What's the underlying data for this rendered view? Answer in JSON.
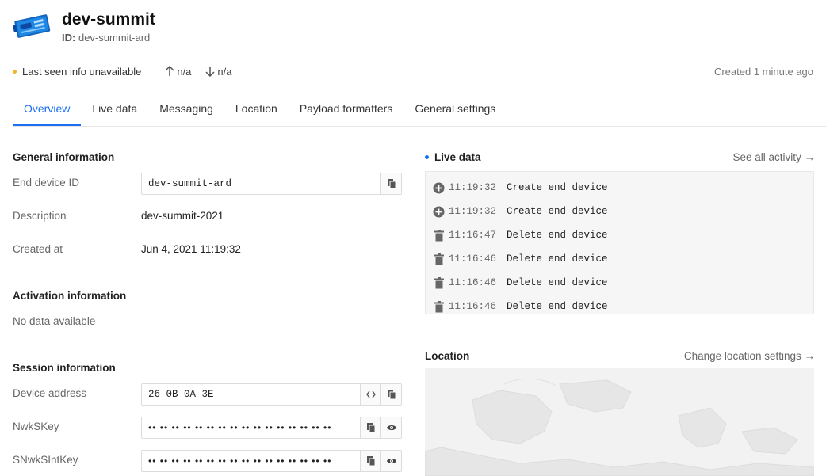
{
  "device": {
    "title": "dev-summit",
    "id_label": "ID:",
    "id_value": "dev-summit-ard"
  },
  "status": {
    "last_seen": "Last seen info unavailable",
    "uplink": "n/a",
    "downlink": "n/a",
    "created": "Created 1 minute ago",
    "warn_color": "#f0b429"
  },
  "tabs": [
    {
      "label": "Overview",
      "active": true
    },
    {
      "label": "Live data"
    },
    {
      "label": "Messaging"
    },
    {
      "label": "Location"
    },
    {
      "label": "Payload formatters"
    },
    {
      "label": "General settings"
    }
  ],
  "general": {
    "title": "General information",
    "end_device_id_label": "End device ID",
    "end_device_id": "dev-summit-ard",
    "description_label": "Description",
    "description": "dev-summit-2021",
    "created_at_label": "Created at",
    "created_at": "Jun 4, 2021 11:19:32"
  },
  "activation": {
    "title": "Activation information",
    "empty": "No data available"
  },
  "session": {
    "title": "Session information",
    "device_address_label": "Device address",
    "device_address": "26 0B 0A 3E",
    "nwkskey_label": "NwkSKey",
    "nwkskey": "•• •• •• •• •• •• •• •• •• •• •• •• •• •• •• ••",
    "snwksintkey_label": "SNwkSIntKey",
    "snwksintkey": "•• •• •• •• •• •• •• •• •• •• •• •• •• •• •• ••"
  },
  "live": {
    "title": "Live data",
    "see_all": "See all activity →",
    "accent": "#1a6ff3",
    "events": [
      {
        "icon": "plus-circle-icon",
        "time": "11:19:32",
        "text": "Create end device"
      },
      {
        "icon": "plus-circle-icon",
        "time": "11:19:32",
        "text": "Create end device"
      },
      {
        "icon": "trash-icon",
        "time": "11:16:47",
        "text": "Delete end device"
      },
      {
        "icon": "trash-icon",
        "time": "11:16:46",
        "text": "Delete end device"
      },
      {
        "icon": "trash-icon",
        "time": "11:16:46",
        "text": "Delete end device"
      },
      {
        "icon": "trash-icon",
        "time": "11:16:46",
        "text": "Delete end device"
      }
    ]
  },
  "location": {
    "title": "Location",
    "change_link": "Change location settings →"
  }
}
